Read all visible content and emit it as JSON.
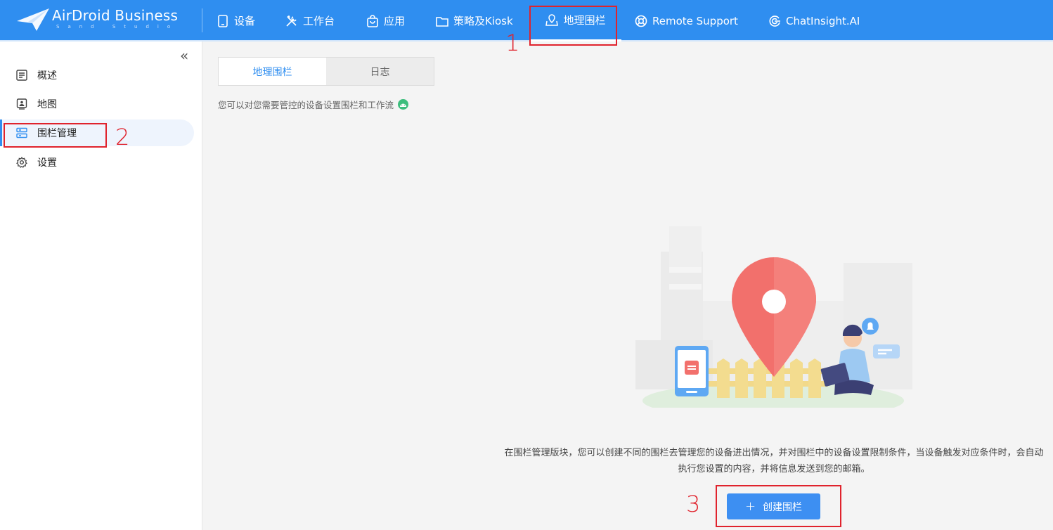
{
  "brand": {
    "name": "AirDroid Business",
    "sub": "Sand Studio"
  },
  "nav": [
    {
      "label": "设备",
      "icon": "tablet-icon"
    },
    {
      "label": "工作台",
      "icon": "tools-icon"
    },
    {
      "label": "应用",
      "icon": "bag-icon"
    },
    {
      "label": "策略及Kiosk",
      "icon": "folder-icon"
    },
    {
      "label": "地理围栏",
      "icon": "map-pin-icon",
      "active": true
    },
    {
      "label": "Remote Support",
      "icon": "lifebuoy-icon"
    },
    {
      "label": "ChatInsight.AI",
      "icon": "chat-ai-icon"
    }
  ],
  "sidebar": {
    "collapse_glyph": "«",
    "items": [
      {
        "label": "概述",
        "icon": "list-icon"
      },
      {
        "label": "地图",
        "icon": "map-icon"
      },
      {
        "label": "围栏管理",
        "icon": "server-icon",
        "active": true
      },
      {
        "label": "设置",
        "icon": "gear-icon"
      }
    ]
  },
  "tabs": [
    {
      "label": "地理围栏",
      "active": true
    },
    {
      "label": "日志"
    }
  ],
  "hint": "您可以对您需要管控的设备设置围栏和工作流",
  "description": "在围栏管理版块，您可以创建不同的围栏去管理您的设备进出情况，并对围栏中的设备设置限制条件，当设备触发对应条件时，会自动执行您设置的内容，并将信息发送到您的邮箱。",
  "create_button": {
    "plus": "+",
    "label": "创建围栏"
  },
  "annotations": [
    "1",
    "2",
    "3"
  ],
  "colors": {
    "accent": "#2f8ef0",
    "annotation": "#e0232d",
    "pin": "#f2706c"
  }
}
